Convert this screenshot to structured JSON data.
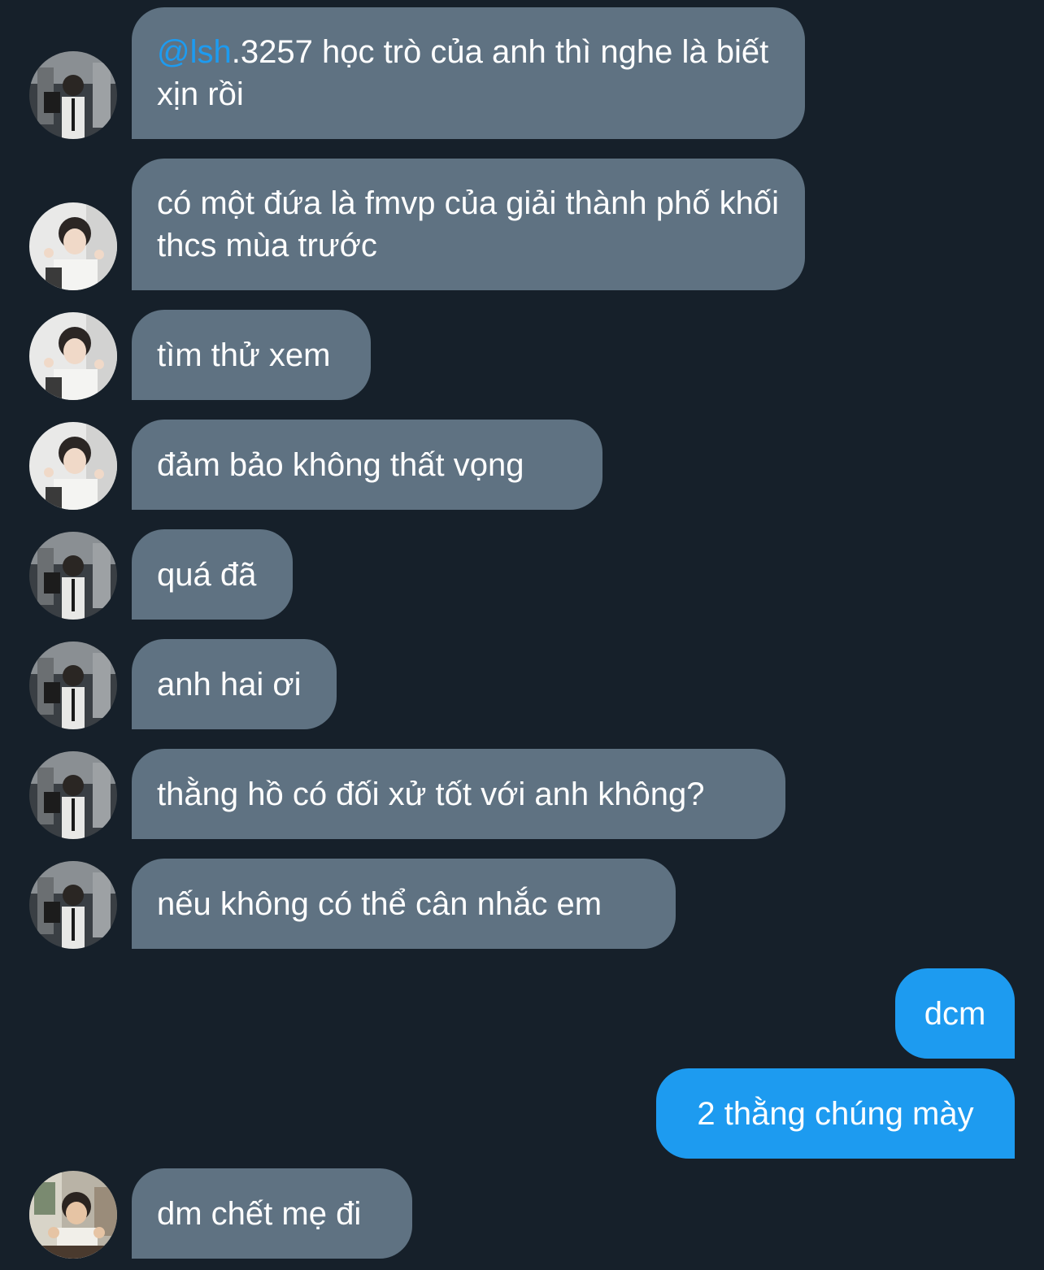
{
  "messages": [
    {
      "side": "in",
      "avatar": "avatar-a",
      "mention": "@lsh",
      "text": ".3257 học trò của anh thì nghe là biết xịn rồi"
    },
    {
      "side": "in",
      "avatar": "avatar-b",
      "text": "có một đứa là fmvp của giải thành phố khối thcs mùa trước"
    },
    {
      "side": "in",
      "avatar": "avatar-b",
      "text": "tìm thử xem"
    },
    {
      "side": "in",
      "avatar": "avatar-b",
      "text": "đảm bảo không thất vọng"
    },
    {
      "side": "in",
      "avatar": "avatar-a",
      "text": "quá đã"
    },
    {
      "side": "in",
      "avatar": "avatar-a",
      "text": "anh hai ơi"
    },
    {
      "side": "in",
      "avatar": "avatar-a",
      "text": "thằng hồ có đối xử tốt với anh không?"
    },
    {
      "side": "in",
      "avatar": "avatar-a",
      "text": "nếu không có thể cân nhắc em"
    },
    {
      "side": "out",
      "text": "dcm"
    },
    {
      "side": "out",
      "text": "2 thằng chúng mày"
    },
    {
      "side": "in",
      "avatar": "avatar-c",
      "text": "dm chết mẹ đi"
    }
  ],
  "colors": {
    "background": "#16202a",
    "incoming_bubble": "#5f7282",
    "outgoing_bubble": "#1d9bf0",
    "mention": "#1d9bf0",
    "text": "#ffffff"
  }
}
